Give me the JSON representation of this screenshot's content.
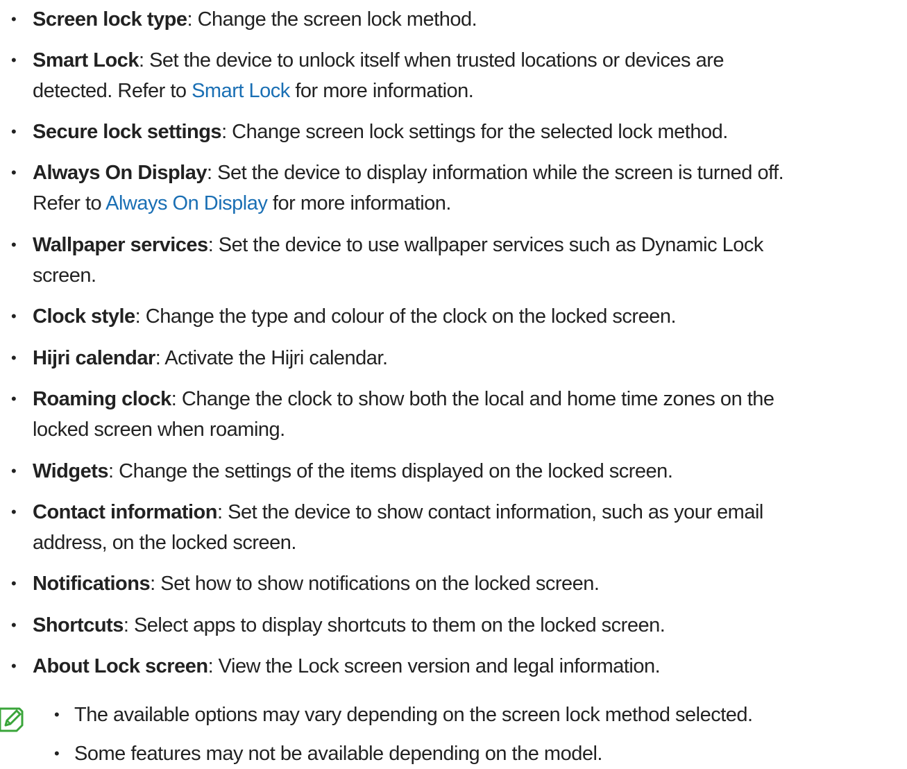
{
  "items": [
    {
      "term": "Screen lock type",
      "text": ": Change the screen lock method."
    },
    {
      "term": "Smart Lock",
      "text1": ": Set the device to unlock itself when trusted locations or devices are",
      "text2a": "detected. Refer to ",
      "link": "Smart Lock",
      "text2b": " for more information."
    },
    {
      "term": "Secure lock settings",
      "text": ": Change screen lock settings for the selected lock method."
    },
    {
      "term": "Always On Display",
      "text1": ": Set the device to display information while the screen is turned off.",
      "text2a": "Refer to ",
      "link": "Always On Display",
      "text2b": " for more information."
    },
    {
      "term": "Wallpaper services",
      "text1": ": Set the device to use wallpaper services such as Dynamic Lock",
      "text2": "screen."
    },
    {
      "term": "Clock style",
      "text": ": Change the type and colour of the clock on the locked screen."
    },
    {
      "term": "Hijri calendar",
      "text": ": Activate the Hijri calendar."
    },
    {
      "term": "Roaming clock",
      "text1": ": Change the clock to show both the local and home time zones on the",
      "text2": "locked screen when roaming."
    },
    {
      "term": "Widgets",
      "text": ": Change the settings of the items displayed on the locked screen."
    },
    {
      "term": "Contact information",
      "text1": ": Set the device to show contact information, such as your email",
      "text2": "address, on the locked screen."
    },
    {
      "term": "Notifications",
      "text": ": Set how to show notifications on the locked screen."
    },
    {
      "term": "Shortcuts",
      "text": ": Select apps to display shortcuts to them on the locked screen."
    },
    {
      "term": "About Lock screen",
      "text": ": View the Lock screen version and legal information."
    }
  ],
  "bullet": "•",
  "notes": [
    "The available options may vary depending on the screen lock method selected.",
    "Some features may not be available depending on the model."
  ],
  "colors": {
    "text": "#222222",
    "link": "#1a6fb4",
    "note_icon": "#3aa53a"
  },
  "icons": {
    "note": "note-pencil-icon"
  }
}
